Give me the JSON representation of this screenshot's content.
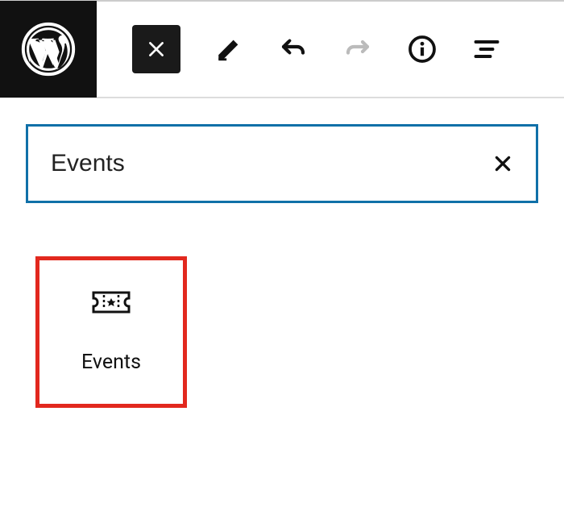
{
  "search": {
    "value": "Events"
  },
  "results": {
    "block1": {
      "label": "Events"
    }
  }
}
